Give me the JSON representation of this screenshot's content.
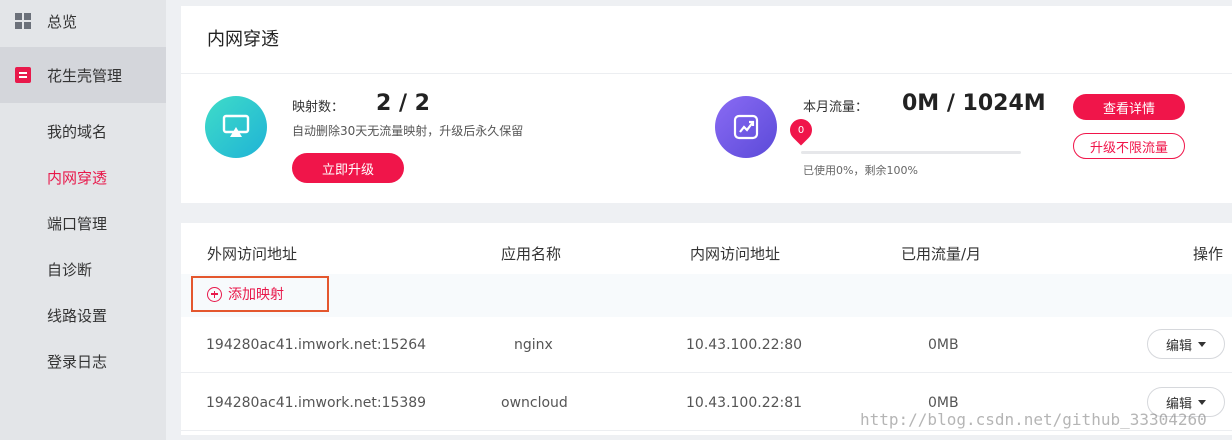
{
  "sidebar": {
    "overview": "总览",
    "group": "花生壳管理",
    "items": [
      {
        "label": "我的域名",
        "active": false
      },
      {
        "label": "内网穿透",
        "active": true
      },
      {
        "label": "端口管理",
        "active": false
      },
      {
        "label": "自诊断",
        "active": false
      },
      {
        "label": "线路设置",
        "active": false
      },
      {
        "label": "登录日志",
        "active": false
      }
    ]
  },
  "page": {
    "title": "内网穿透"
  },
  "mapping": {
    "label": "映射数：",
    "value": "2 / 2",
    "note": "自动删除30天无流量映射，升级后永久保留",
    "upgrade_button": "立即升级"
  },
  "traffic": {
    "label": "本月流量：",
    "value": "0M / 1024M",
    "marker": "0",
    "used_fraction": 0,
    "usage_text": "已使用0%，剩余100%",
    "details_button": "查看详情",
    "unlimited_button": "升级不限流量"
  },
  "table": {
    "headers": [
      "外网访问地址",
      "应用名称",
      "内网访问地址",
      "已用流量/月",
      "操作"
    ],
    "add_label": "添加映射",
    "rows": [
      {
        "external": "194280ac41.imwork.net:15264",
        "app": "nginx",
        "internal": "10.43.100.22:80",
        "traffic": "0MB",
        "action": "编辑"
      },
      {
        "external": "194280ac41.imwork.net:15389",
        "app": "owncloud",
        "internal": "10.43.100.22:81",
        "traffic": "0MB",
        "action": "编辑"
      }
    ]
  },
  "watermark": "http://blog.csdn.net/github_33304260",
  "colors": {
    "accent": "#f0154a",
    "teal": "#1fb3d6",
    "purple": "#6b57e6"
  }
}
